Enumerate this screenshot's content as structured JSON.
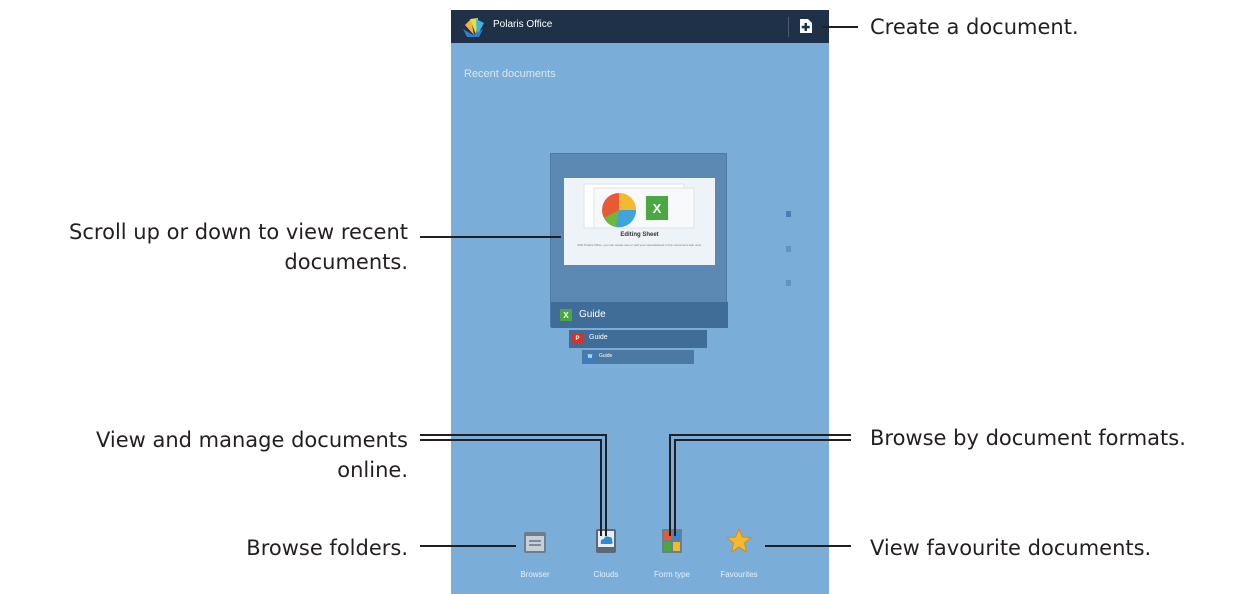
{
  "app": {
    "title": "Polaris Office",
    "header_color": "#1e3147",
    "background_color": "#7aaed8",
    "create_icon": "new-document-icon"
  },
  "main": {
    "section_title": "Recent documents",
    "featured_doc": {
      "thumbnail_title": "Editing Sheet",
      "thumbnail_caption": "With Polaris Office, you can create new or edit your spreadsheets in the convenient web view.",
      "name": "Guide",
      "type_icon": "spreadsheet-icon"
    },
    "stack_docs": [
      {
        "name": "Guide",
        "type_icon": "pdf-icon"
      },
      {
        "name": "Guide",
        "type_icon": "word-doc-icon"
      }
    ]
  },
  "bottom_nav": [
    {
      "label": "Browser",
      "icon": "folder-icon"
    },
    {
      "label": "Clouds",
      "icon": "cloud-icon"
    },
    {
      "label": "Form type",
      "icon": "form-type-icon"
    },
    {
      "label": "Favourites",
      "icon": "star-icon"
    }
  ],
  "callouts": {
    "create": "Create a document.",
    "scroll": [
      "Scroll up or down to view recent",
      "documents."
    ],
    "online": [
      "View and manage documents",
      "online."
    ],
    "folders": "Browse folders.",
    "formats": "Browse by document formats.",
    "favourites": "View favourite documents."
  }
}
